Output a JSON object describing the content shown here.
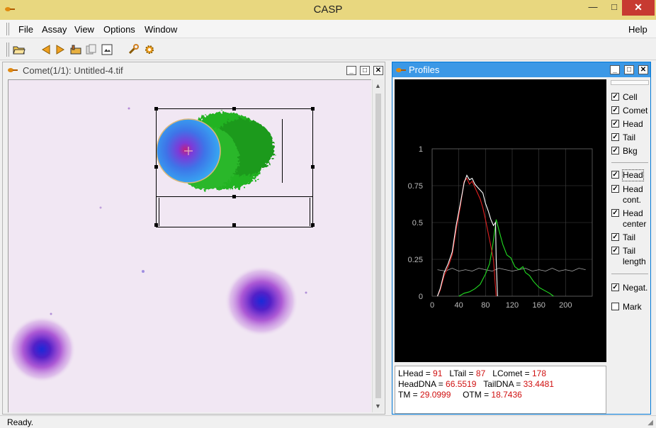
{
  "app": {
    "title": "CASP",
    "window_controls": {
      "minimize": "—",
      "maximize": "□",
      "close": "✕"
    }
  },
  "menu": {
    "items": [
      "File",
      "Assay",
      "View",
      "Options",
      "Window"
    ],
    "help": "Help"
  },
  "toolbar": {
    "icons": [
      "open-folder-icon",
      "previous-arrow-icon",
      "next-arrow-icon",
      "measure-icon",
      "copy-icon",
      "export-icon",
      "tools-icon",
      "settings-icon"
    ]
  },
  "comet_window": {
    "title": "Comet(1/1): Untitled-4.tif"
  },
  "profiles_window": {
    "title": "Profiles",
    "options_group1": [
      {
        "label": "Cell",
        "checked": true
      },
      {
        "label": "Comet",
        "checked": true
      },
      {
        "label": "Head",
        "checked": true
      },
      {
        "label": "Tail",
        "checked": true
      },
      {
        "label": "Bkg",
        "checked": true
      }
    ],
    "options_group2": [
      {
        "label": "Head",
        "checked": true
      },
      {
        "label": "Head cont.",
        "checked": true
      },
      {
        "label": "Head center",
        "checked": true
      },
      {
        "label": "Tail",
        "checked": true
      },
      {
        "label": "Tail length",
        "checked": true
      }
    ],
    "options_group3": [
      {
        "label": "Negat.",
        "checked": true
      },
      {
        "label": "Mark",
        "checked": false
      }
    ],
    "readout": {
      "lhead_label": "LHead = ",
      "lhead": "91",
      "ltail_label": "LTail = ",
      "ltail": "87",
      "lcomet_label": "LComet = ",
      "lcomet": "178",
      "headdna_label": "HeadDNA = ",
      "headdna": "66.5519",
      "taildna_label": "TailDNA = ",
      "taildna": "33.4481",
      "tm_label": "TM = ",
      "tm": "29.0999",
      "otm_label": "OTM = ",
      "otm": "18.7436"
    }
  },
  "chart_data": {
    "type": "line",
    "xlim": [
      0,
      240
    ],
    "ylim": [
      0,
      1
    ],
    "x_ticks": [
      "0",
      "40",
      "80",
      "120",
      "160",
      "200"
    ],
    "x_tick_values": [
      0,
      40,
      80,
      120,
      160,
      200
    ],
    "y_ticks": [
      "0",
      "0.25",
      "0.5",
      "0.75",
      "1"
    ],
    "y_tick_values": [
      0,
      0.25,
      0.5,
      0.75,
      1
    ],
    "grid": true,
    "colors": {
      "comet": "#ffffff",
      "head": "#e02020",
      "tail": "#22dd22",
      "bkg": "#aaaaaa"
    },
    "series": [
      {
        "id": "comet",
        "x": [
          8,
          12,
          18,
          24,
          30,
          36,
          42,
          48,
          52,
          56,
          60,
          64,
          68,
          72,
          76,
          80,
          84,
          88,
          92,
          95,
          96,
          98
        ],
        "y": [
          0,
          0.05,
          0.16,
          0.22,
          0.3,
          0.48,
          0.62,
          0.77,
          0.82,
          0.79,
          0.8,
          0.76,
          0.74,
          0.72,
          0.7,
          0.63,
          0.58,
          0.52,
          0.48,
          0.5,
          0.25,
          0.0
        ]
      },
      {
        "id": "head",
        "x": [
          8,
          12,
          18,
          24,
          30,
          36,
          42,
          48,
          52,
          56,
          60,
          64,
          68,
          72,
          76,
          80,
          84,
          88,
          92,
          94,
          96
        ],
        "y": [
          0,
          0.04,
          0.14,
          0.2,
          0.28,
          0.45,
          0.6,
          0.78,
          0.8,
          0.76,
          0.78,
          0.74,
          0.7,
          0.66,
          0.6,
          0.52,
          0.43,
          0.34,
          0.25,
          0.12,
          0.0
        ]
      },
      {
        "id": "tail",
        "x": [
          40,
          48,
          56,
          64,
          72,
          80,
          86,
          90,
          94,
          96,
          100,
          106,
          112,
          118,
          124,
          130,
          136,
          140,
          146,
          152,
          160,
          168,
          176,
          182
        ],
        "y": [
          0,
          0.02,
          0.03,
          0.05,
          0.08,
          0.15,
          0.22,
          0.32,
          0.45,
          0.52,
          0.45,
          0.35,
          0.28,
          0.26,
          0.2,
          0.18,
          0.2,
          0.16,
          0.14,
          0.1,
          0.06,
          0.04,
          0.02,
          0.0
        ]
      },
      {
        "id": "bkg",
        "x": [
          8,
          20,
          30,
          40,
          50,
          60,
          70,
          80,
          90,
          100,
          110,
          120,
          130,
          140,
          150,
          160,
          170,
          180,
          190,
          200,
          210,
          220,
          230
        ],
        "y": [
          0.18,
          0.17,
          0.19,
          0.17,
          0.18,
          0.17,
          0.19,
          0.18,
          0.17,
          0.19,
          0.18,
          0.17,
          0.18,
          0.19,
          0.17,
          0.18,
          0.17,
          0.19,
          0.17,
          0.18,
          0.17,
          0.19,
          0.18
        ]
      }
    ]
  },
  "status": {
    "text": "Ready."
  }
}
